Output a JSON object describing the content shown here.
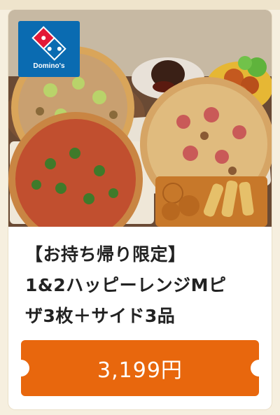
{
  "brand": {
    "logo_text": "Domino's",
    "logo_color": "#0a6bb1"
  },
  "offer": {
    "title_line1": "【お持ち帰り限定】",
    "title_line2": "1&2ハッピーレンジMピ",
    "title_line3": "ザ3枚＋サイド3品"
  },
  "price_button": {
    "label": "3,199円",
    "color": "#e8670d"
  }
}
